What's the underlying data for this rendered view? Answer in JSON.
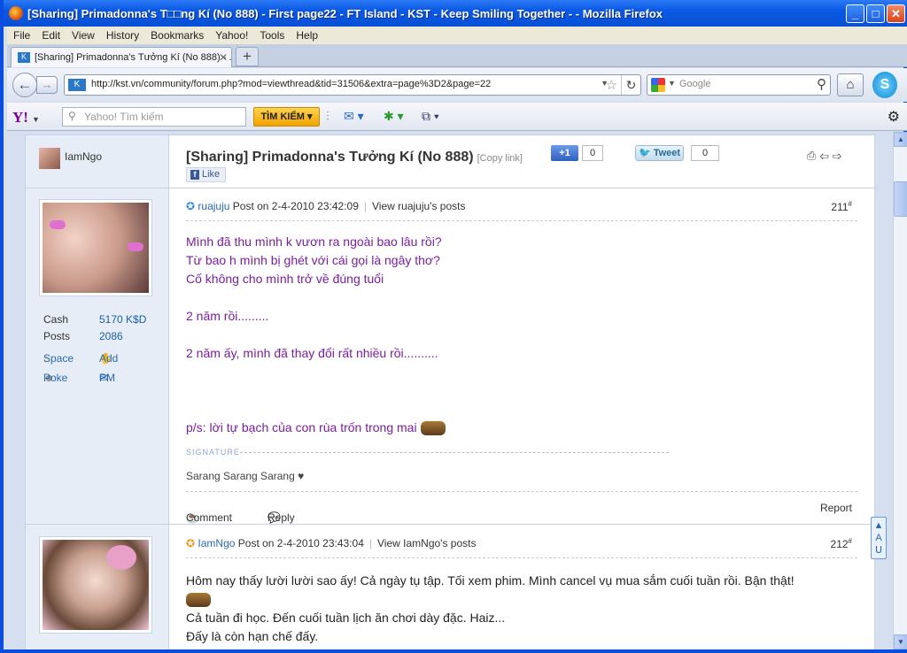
{
  "window": {
    "title": "[Sharing] Primadonna's T□□ng Kí (No 888) - First page22 - FT Island - KST - Keep Smiling Together - - Mozilla Firefox"
  },
  "menu": [
    "File",
    "Edit",
    "View",
    "History",
    "Bookmarks",
    "Yahoo!",
    "Tools",
    "Help"
  ],
  "tab": {
    "label": "[Sharing] Primadonna's Tưởng Kí (No 888) - ..."
  },
  "nav": {
    "url": "http://kst.vn/community/forum.php?mod=viewthread&tid=31506&extra=page%3D2&page=22",
    "search_placeholder": "Google"
  },
  "yahoo": {
    "logo": "Y!",
    "search_placeholder": "Yahoo! Tìm kiếm",
    "search_button": "TÌM KIẾM"
  },
  "thread": {
    "top_user": "IamNgo",
    "title": "[Sharing] Primadonna's Tưởng Kí (No 888)",
    "copy_link": "[Copy link]",
    "gplus_label": "+1",
    "gplus_count": "0",
    "tweet_label": "Tweet",
    "tweet_count": "0",
    "fb_like": "Like"
  },
  "posts": [
    {
      "author": "ruajuju",
      "meta": "Post on 2-4-2010 23:42:09",
      "view_posts": "View ruajuju's posts",
      "number": "211",
      "cash_label": "Cash",
      "cash_value": "5170 K$D",
      "posts_label": "Posts",
      "posts_value": "2086",
      "space": "Space",
      "add": "Add",
      "poke": "Poke",
      "pm": "PM",
      "lines": [
        "Mình đã thu mình k vươn ra ngoài bao lâu rồi?",
        "Từ bao h mình bị ghét với cái gọi là ngây thơ?",
        "Cố không cho mình trở về đúng tuổi",
        "",
        "2 năm rồi.........",
        "",
        "2 năm ấy, mình đã thay đổi rất nhiều rồi..........",
        "",
        "",
        "",
        "p/s: lời tự bạch của con rùa trốn trong mai"
      ],
      "signature_label": "SIGNATURE",
      "signature": "Sarang Sarang Sarang ♥",
      "comment": "Comment",
      "reply": "Reply",
      "report": "Report"
    },
    {
      "author": "IamNgo",
      "meta": "Post on 2-4-2010 23:43:04",
      "view_posts": "View IamNgo's posts",
      "number": "212",
      "lines": [
        "Hôm nay thấy lười lười sao ấy! Cả ngày tụ tập. Tối xem phim. Mình cancel vụ mua sắm cuối tuần rồi. Bận thật!",
        "",
        "Cả tuần đi học. Đến cuối tuần lịch ăn chơi dày đặc. Haiz...",
        "Đấy là còn hạn chế đấy."
      ]
    }
  ],
  "colors": {
    "post_text": "#7a1e9e",
    "link": "#2a6ab0",
    "titlebar": "#0a58e4"
  }
}
